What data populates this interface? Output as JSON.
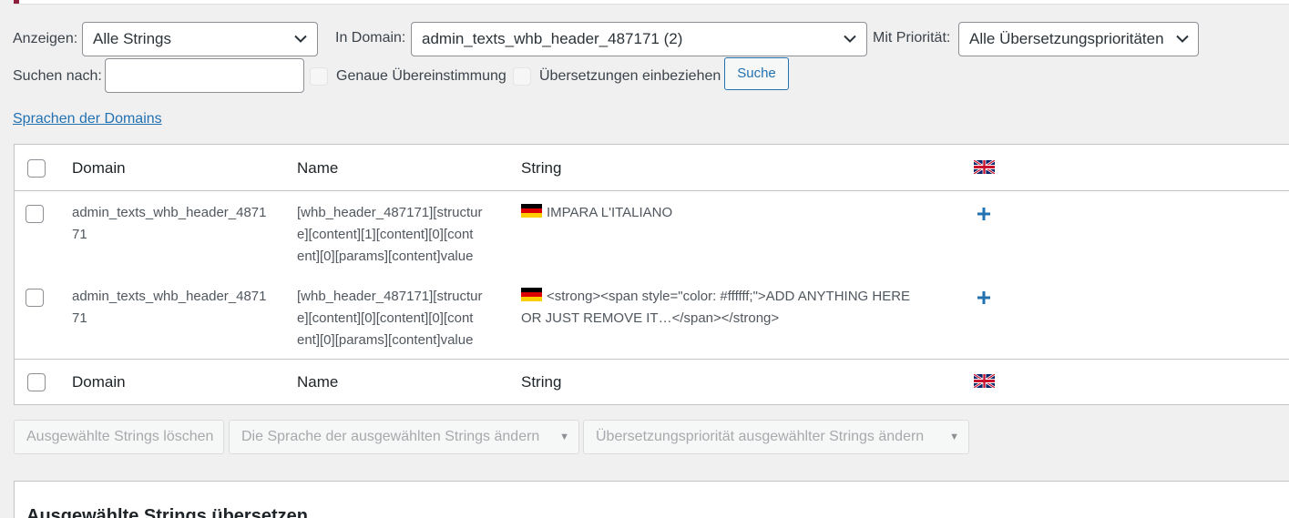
{
  "filters": {
    "show_label": "Anzeigen:",
    "show_value": "Alle Strings",
    "domain_label": "In Domain:",
    "domain_value": "admin_texts_whb_header_487171 (2)",
    "priority_label": "Mit Priorität:",
    "priority_value": "Alle Übersetzungsprioritäten",
    "search_label": "Suchen nach:",
    "search_value": "",
    "exact_match_label": "Genaue Übereinstimmung",
    "include_translations_label": "Übersetzungen einbeziehen",
    "search_button": "Suche"
  },
  "domain_languages_link": "Sprachen der Domains",
  "table": {
    "headers": {
      "domain": "Domain",
      "name": "Name",
      "string": "String"
    },
    "rows": [
      {
        "domain_line1": "admin_texts_whb_header_4871",
        "domain_line2": "71",
        "name_line1": "[whb_header_487171][structur",
        "name_line2": "e][content][1][content][0][cont",
        "name_line3": "ent][0][params][content]value",
        "string_line1": "IMPARA L'ITALIANO",
        "string_line2": ""
      },
      {
        "domain_line1": "admin_texts_whb_header_4871",
        "domain_line2": "71",
        "name_line1": "[whb_header_487171][structur",
        "name_line2": "e][content][0][content][0][cont",
        "name_line3": "ent][0][params][content]value",
        "string_line1": "<strong><span style=\"color: #ffffff;\">ADD ANYTHING HERE",
        "string_line2": "OR JUST REMOVE IT…</span></strong>"
      }
    ]
  },
  "bulk": {
    "delete_button": "Ausgewählte Strings löschen",
    "change_language": "Die Sprache der ausgewählten Strings ändern",
    "change_priority": "Übersetzungspriorität ausgewählter Strings ändern"
  },
  "translate_section_title": "Ausgewählte Strings übersetzen",
  "colors": {
    "link": "#2271b1",
    "accent": "#8c1f3a",
    "plus": "#2271b1"
  }
}
